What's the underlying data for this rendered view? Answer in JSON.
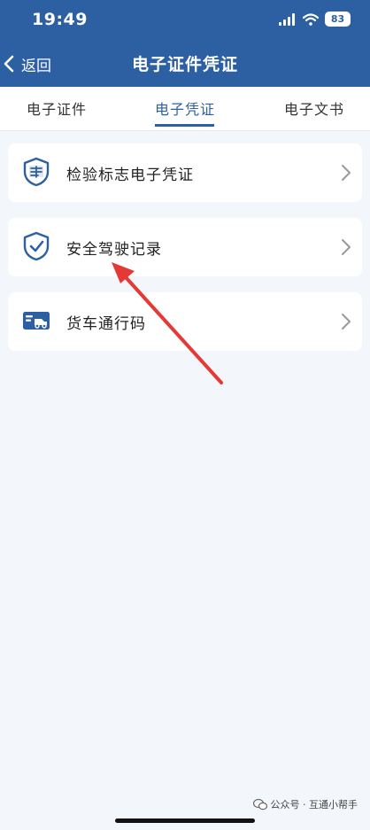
{
  "status_bar": {
    "time": "19:49",
    "battery": "83"
  },
  "nav": {
    "back_label": "返回",
    "title": "电子证件凭证"
  },
  "tabs": [
    {
      "label": "电子证件",
      "active": false
    },
    {
      "label": "电子凭证",
      "active": true
    },
    {
      "label": "电子文书",
      "active": false
    }
  ],
  "items": [
    {
      "label": "检验标志电子凭证",
      "icon": "certificate-shield-icon"
    },
    {
      "label": "安全驾驶记录",
      "icon": "check-shield-icon"
    },
    {
      "label": "货车通行码",
      "icon": "truck-card-icon"
    }
  ],
  "colors": {
    "primary": "#2d5fa3",
    "background": "#f3f6fa",
    "annotation": "#e53935"
  },
  "watermark": {
    "text": "公众号 · 互通小帮手"
  }
}
